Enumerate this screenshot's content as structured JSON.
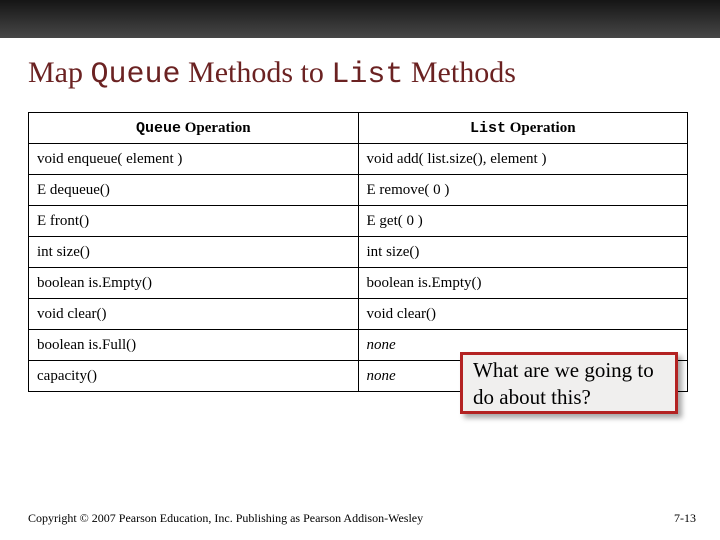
{
  "title": {
    "t1": "Map ",
    "t2": "Queue",
    "t3": " Methods to ",
    "t4": "List",
    "t5": " Methods"
  },
  "table": {
    "header": {
      "left_prefix": "Queue",
      "left_suffix": " Operation",
      "right_prefix": "List",
      "right_suffix": " Operation"
    },
    "rows": [
      {
        "q": "void enqueue( element )",
        "l": "void add( list.size(), element )"
      },
      {
        "q": "E dequeue()",
        "l": "E remove( 0 )"
      },
      {
        "q": "E front()",
        "l": "E get( 0 )"
      },
      {
        "q": "int size()",
        "l": "int size()"
      },
      {
        "q": "boolean is.Empty()",
        "l": "boolean is.Empty()"
      },
      {
        "q": "void clear()",
        "l": "void clear()"
      },
      {
        "q": "boolean is.Full()",
        "l": "none",
        "none": true
      },
      {
        "q": "capacity()",
        "l": "none",
        "none": true
      }
    ]
  },
  "callout": "What are we going to do about this?",
  "footer": {
    "copyright": "Copyright © 2007 Pearson Education, Inc. Publishing as Pearson Addison-Wesley",
    "page": "7-13"
  }
}
